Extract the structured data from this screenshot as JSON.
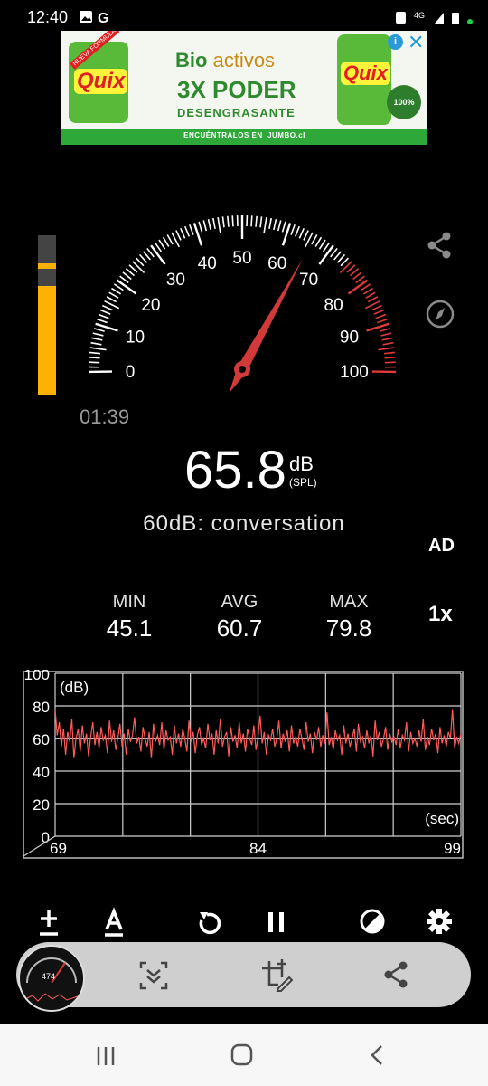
{
  "status_bar": {
    "time": "12:40",
    "network": "4G"
  },
  "ad": {
    "brand_left": "Quix",
    "badge": "NUEVA FÓRMULA",
    "line1_a": "Bio",
    "line1_b": "activos",
    "line2": "3X PODER",
    "line3": "DESENGRASANTE",
    "footer": "ENCUÉNTRALOS EN",
    "store": "JUMBO.cl",
    "brand_right": "Quix",
    "seal": "100%"
  },
  "meter": {
    "dial_labels": [
      "0",
      "10",
      "20",
      "30",
      "40",
      "50",
      "60",
      "70",
      "80",
      "90",
      "100"
    ],
    "needle_value": 65.8,
    "level_fraction": 0.68,
    "peak_fraction": 0.79,
    "timer": "01:39",
    "value": "65.8",
    "unit": "dB",
    "unit_sub": "(SPL)",
    "description": "60dB: conversation",
    "ad_label": "AD"
  },
  "stats": {
    "min_label": "MIN",
    "min_value": "45.1",
    "avg_label": "AVG",
    "avg_value": "60.7",
    "max_label": "MAX",
    "max_value": "79.8",
    "speed": "1x"
  },
  "chart_data": {
    "type": "line",
    "title": "",
    "ylabel": "(dB)",
    "xlabel": "(sec)",
    "ylim": [
      0,
      100
    ],
    "xlim": [
      69,
      99
    ],
    "y_ticks": [
      "100",
      "80",
      "60",
      "40",
      "20",
      "0"
    ],
    "x_ticks": [
      "69",
      "84",
      "99"
    ],
    "reference_line": 60,
    "series": [
      {
        "color": "#ff5a5a",
        "values": [
          78,
          62,
          70,
          55,
          66,
          50,
          64,
          58,
          72,
          48,
          60,
          66,
          52,
          68,
          57,
          63,
          49,
          61,
          70,
          56,
          64,
          54,
          67,
          59,
          62,
          51,
          71,
          58,
          65,
          53,
          60,
          69,
          55,
          63,
          50,
          66,
          58,
          62,
          73,
          57,
          61,
          52,
          67,
          60,
          55,
          64,
          48,
          69,
          58,
          62,
          56,
          70,
          53,
          65,
          59,
          61,
          50,
          68,
          57,
          63,
          55,
          66,
          60,
          52,
          71,
          58,
          64,
          51,
          62,
          67,
          56,
          60,
          54,
          69,
          59,
          63,
          50,
          65,
          57,
          72,
          55,
          61,
          64,
          49,
          67,
          58,
          62,
          54,
          70,
          57,
          63,
          52,
          66,
          60,
          56,
          68,
          53,
          61,
          74,
          57,
          64,
          50,
          62,
          59,
          66,
          55,
          60,
          71,
          54,
          63,
          58,
          65,
          52,
          68,
          57,
          61,
          55,
          66,
          60,
          53,
          70,
          58,
          63,
          51,
          64,
          59,
          67,
          55,
          62,
          57,
          76,
          56,
          61,
          53,
          65,
          59,
          62,
          50,
          68,
          57,
          63,
          55,
          60,
          66,
          52,
          69,
          58,
          61,
          54,
          65,
          57,
          62,
          49,
          71,
          59,
          64,
          55,
          60,
          67,
          53,
          63,
          58,
          61,
          56,
          66,
          54,
          62,
          59,
          70,
          52,
          64,
          57,
          60,
          55,
          65,
          58,
          72,
          53,
          61,
          56,
          66,
          59,
          63,
          51,
          67,
          57,
          62,
          55,
          64,
          60,
          78,
          54,
          61,
          57,
          63
        ]
      }
    ]
  },
  "toolbar": {
    "calibrate_icon": "plus-minus-icon",
    "weighting_icon": "a-weighting-icon",
    "reset_icon": "reset-icon",
    "pause_icon": "pause-icon",
    "theme_icon": "theme-icon",
    "settings_icon": "gear-icon"
  },
  "capture_panel": {
    "thumb_value": "474"
  }
}
